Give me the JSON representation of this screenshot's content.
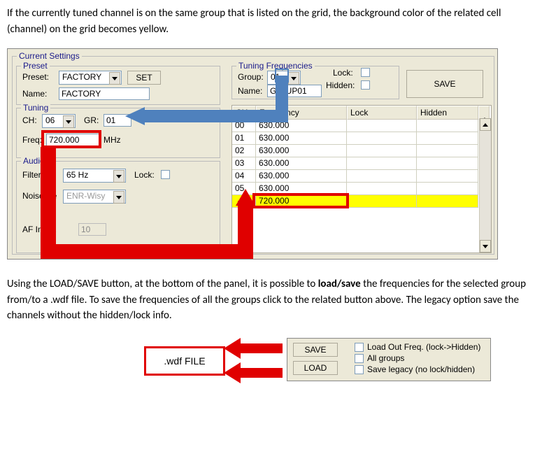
{
  "prose": {
    "p1": "If the currently tuned channel is on the same group that is listed on the grid, the background color of the related cell (channel) on the grid becomes yellow.",
    "p2a": "Using the LOAD/SAVE button, at the bottom of the panel, it is possible to ",
    "p2b": "load/save",
    "p2c": " the frequencies for the selected group from/to a .wdf file. To save the frequencies of all the groups click to the related button above. The legacy option save the channels without the hidden/lock info."
  },
  "fig1": {
    "groups": {
      "current": "Current Settings",
      "preset": "Preset",
      "tuning": "Tuning",
      "audio": "Audio",
      "tfreq": "Tuning Frequencies"
    },
    "preset": {
      "preset_lbl": "Preset:",
      "preset_val": "FACTORY",
      "set_btn": "SET",
      "name_lbl": "Name:",
      "name_val": "FACTORY"
    },
    "tuning": {
      "ch_lbl": "CH:",
      "ch_val": "06",
      "gr_lbl": "GR:",
      "gr_val": "01",
      "freq_lbl": "Freq:",
      "freq_val": "720.000",
      "freq_unit": "MHz"
    },
    "audio": {
      "filter_lbl": "Filter:",
      "filter_val": "65 Hz",
      "lock_lbl": "Lock:",
      "nr_lbl": "Noise Re",
      "nr_val": "ENR-Wisy",
      "afin_lbl": "AF In Ga",
      "afin_val": "10"
    },
    "tfreq": {
      "group_lbl": "Group:",
      "group_val": "01",
      "lock_lbl": "Lock:",
      "hidden_lbl": "Hidden:",
      "name_lbl": "Name:",
      "name_val": "G    UP01"
    },
    "save_btn": "SAVE",
    "grid": {
      "headers": {
        "ch": "CH",
        "freq": "Frequency",
        "lock": "Lock",
        "hidden": "Hidden"
      },
      "rows": [
        {
          "ch": "00",
          "freq": "630.000",
          "lock": "",
          "hidden": "",
          "hl": false
        },
        {
          "ch": "01",
          "freq": "630.000",
          "lock": "",
          "hidden": "",
          "hl": false
        },
        {
          "ch": "02",
          "freq": "630.000",
          "lock": "",
          "hidden": "",
          "hl": false
        },
        {
          "ch": "03",
          "freq": "630.000",
          "lock": "",
          "hidden": "",
          "hl": false
        },
        {
          "ch": "04",
          "freq": "630.000",
          "lock": "",
          "hidden": "",
          "hl": false
        },
        {
          "ch": "05",
          "freq": "630.000",
          "lock": "",
          "hidden": "",
          "hl": false
        },
        {
          "ch": "",
          "freq": "720.000",
          "lock": "",
          "hidden": "",
          "hl": true
        }
      ]
    }
  },
  "fig2": {
    "wdf_label": ".wdf FILE",
    "save_btn": "SAVE",
    "load_btn": "LOAD",
    "opt1": "Load Out Freq. (lock->Hidden)",
    "opt2": "All groups",
    "opt3": "Save legacy (no lock/hidden)"
  }
}
